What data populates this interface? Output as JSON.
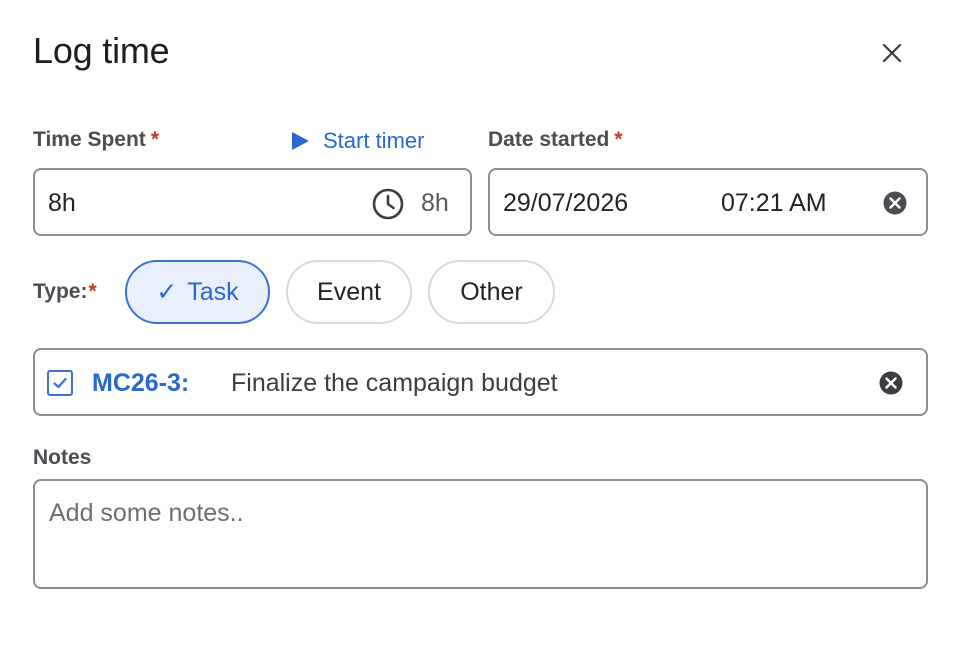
{
  "dialog": {
    "title": "Log time",
    "close_icon": "close-icon"
  },
  "time_spent": {
    "label": "Time Spent",
    "required_mark": "*",
    "value": "8h",
    "estimate": "8h",
    "clock_icon": "clock-icon"
  },
  "start_timer": {
    "label": "Start timer",
    "icon": "play-icon"
  },
  "date_started": {
    "label": "Date started",
    "required_mark": "*",
    "date": "29/07/2026",
    "time": "07:21 AM",
    "clear_icon": "clear-icon"
  },
  "type": {
    "label": "Type:",
    "required_mark": "*",
    "options": [
      {
        "label": "Task",
        "selected": true,
        "check": "✓"
      },
      {
        "label": "Event",
        "selected": false
      },
      {
        "label": "Other",
        "selected": false
      }
    ]
  },
  "task": {
    "key": "MC26-3:",
    "title": "Finalize the campaign budget",
    "checkbox_icon": "checkbox-icon",
    "clear_icon": "clear-icon"
  },
  "notes": {
    "label": "Notes",
    "placeholder": "Add some notes..",
    "value": ""
  },
  "colors": {
    "accent": "#2b67d1",
    "required": "#c0392b",
    "border": "#8a8d91",
    "selected_bg": "#e9f0fc"
  }
}
